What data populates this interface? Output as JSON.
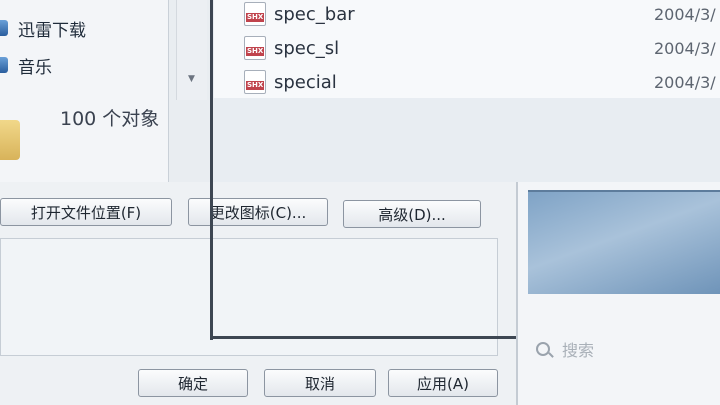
{
  "nav": {
    "items": [
      {
        "label": "迅雷下载",
        "icon": "thunder-download-icon"
      },
      {
        "label": "音乐",
        "icon": "music-icon"
      }
    ]
  },
  "status": {
    "object_count": "100 个对象"
  },
  "files": [
    {
      "name": "spec_bar",
      "date": "2004/3/",
      "icon": "shx-file-icon",
      "badge": "SHX"
    },
    {
      "name": "spec_sl",
      "date": "2004/3/",
      "icon": "shx-file-icon",
      "badge": "SHX"
    },
    {
      "name": "special",
      "date": "2004/3/",
      "icon": "shx-file-icon",
      "badge": "SHX"
    }
  ],
  "dialog": {
    "open_location_label": "打开文件位置(F)",
    "change_icon_label": "更改图标(C)...",
    "advanced_label": "高级(D)...",
    "ok_label": "确定",
    "cancel_label": "取消",
    "apply_label": "应用(A)"
  },
  "search": {
    "placeholder": "搜索"
  }
}
